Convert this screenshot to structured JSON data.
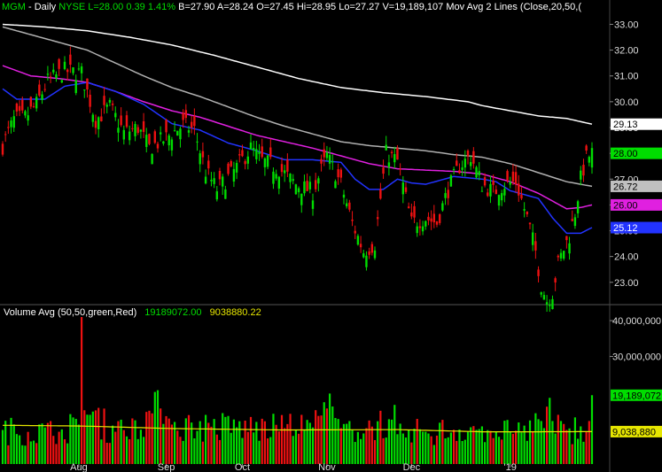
{
  "header": {
    "symbol": "MGM",
    "interval": "Daily",
    "exchange": "NYSE",
    "last": "L=28.00",
    "change": "0.39",
    "change_pct": "1.41%",
    "bid": "B=27.90",
    "ask": "A=28.24",
    "open": "O=27.45",
    "high": "Hi=28.95",
    "low": "Lo=27.27",
    "volume": "V=19,189,107",
    "study": "Mov Avg 2 Lines (Close,20,50,("
  },
  "volume_header": {
    "label": "Volume Avg (50,50,green,Red)",
    "value1": "19189072.00",
    "value2": "9038880.22"
  },
  "colors": {
    "up": "#00dd00",
    "down": "#ee1111",
    "ma20": "#2233ff",
    "ma50": "#e020e0",
    "ma100": "#b0b0b0",
    "ma200": "#ffffff",
    "vol_avg": "#e6e600",
    "grid": "#333333"
  },
  "chart_data": {
    "type": "candlestick",
    "price_axis": {
      "ticks": [
        "33.00",
        "32.00",
        "31.00",
        "30.00",
        "29.00",
        "28.00",
        "27.00",
        "26.00",
        "25.00",
        "24.00",
        "23.00"
      ],
      "ylim": [
        22.1,
        33.6
      ]
    },
    "volume_axis": {
      "ticks": [
        "40,000,000",
        "30,000,000"
      ],
      "ylim": [
        0,
        41000000
      ]
    },
    "x_labels": [
      "Aug",
      "Sep",
      "Oct",
      "Nov",
      "Dec",
      "'19"
    ],
    "price_tags": [
      {
        "label": "29.13",
        "value": 29.13,
        "color": "#ffffff",
        "text": "#000000"
      },
      {
        "label": "28.00",
        "value": 28.0,
        "color": "#00dd00",
        "text": "#000000"
      },
      {
        "label": "26.72",
        "value": 26.72,
        "color": "#c0c0c0",
        "text": "#000000"
      },
      {
        "label": "26.00",
        "value": 26.0,
        "color": "#e020e0",
        "text": "#000000"
      },
      {
        "label": "25.12",
        "value": 25.12,
        "color": "#2233ff",
        "text": "#ffffff"
      }
    ],
    "volume_tags": [
      {
        "label": "19,189,072",
        "value": 19189072,
        "color": "#00dd00",
        "text": "#000000"
      },
      {
        "label": "9,038,880",
        "value": 9038880,
        "color": "#e6e600",
        "text": "#000000"
      }
    ],
    "series": [
      {
        "name": "Mov Avg 200",
        "key": "ma200",
        "values": [
          [
            0,
            33.0
          ],
          [
            15,
            32.9
          ],
          [
            30,
            32.75
          ],
          [
            45,
            32.5
          ],
          [
            60,
            32.2
          ],
          [
            75,
            31.8
          ],
          [
            90,
            31.35
          ],
          [
            105,
            30.9
          ],
          [
            120,
            30.55
          ],
          [
            135,
            30.35
          ],
          [
            150,
            30.2
          ],
          [
            165,
            30.0
          ],
          [
            170,
            29.85
          ],
          [
            180,
            29.65
          ],
          [
            190,
            29.45
          ],
          [
            200,
            29.35
          ],
          [
            209,
            29.13
          ]
        ]
      },
      {
        "name": "Mov Avg 100",
        "key": "ma100",
        "values": [
          [
            0,
            32.9
          ],
          [
            10,
            32.6
          ],
          [
            20,
            32.3
          ],
          [
            30,
            32.0
          ],
          [
            40,
            31.5
          ],
          [
            50,
            31.0
          ],
          [
            60,
            30.55
          ],
          [
            70,
            30.2
          ],
          [
            80,
            29.8
          ],
          [
            90,
            29.4
          ],
          [
            100,
            29.05
          ],
          [
            110,
            28.75
          ],
          [
            120,
            28.45
          ],
          [
            130,
            28.3
          ],
          [
            140,
            28.2
          ],
          [
            150,
            28.1
          ],
          [
            160,
            27.95
          ],
          [
            170,
            27.85
          ],
          [
            180,
            27.6
          ],
          [
            190,
            27.25
          ],
          [
            200,
            26.9
          ],
          [
            209,
            26.72
          ]
        ]
      },
      {
        "name": "Mov Avg 50",
        "key": "ma50",
        "values": [
          [
            0,
            31.4
          ],
          [
            10,
            31.0
          ],
          [
            20,
            30.9
          ],
          [
            30,
            30.75
          ],
          [
            40,
            30.4
          ],
          [
            50,
            30.0
          ],
          [
            60,
            29.65
          ],
          [
            70,
            29.4
          ],
          [
            80,
            29.05
          ],
          [
            90,
            28.7
          ],
          [
            100,
            28.45
          ],
          [
            110,
            28.2
          ],
          [
            120,
            27.9
          ],
          [
            130,
            27.6
          ],
          [
            140,
            27.4
          ],
          [
            150,
            27.35
          ],
          [
            160,
            27.3
          ],
          [
            170,
            27.2
          ],
          [
            180,
            26.9
          ],
          [
            190,
            26.45
          ],
          [
            200,
            25.85
          ],
          [
            205,
            25.9
          ],
          [
            209,
            26.0
          ]
        ]
      },
      {
        "name": "Mov Avg 20",
        "key": "ma20",
        "values": [
          [
            0,
            30.5
          ],
          [
            5,
            30.1
          ],
          [
            15,
            30.1
          ],
          [
            22,
            30.6
          ],
          [
            30,
            30.75
          ],
          [
            40,
            30.4
          ],
          [
            50,
            29.9
          ],
          [
            60,
            29.15
          ],
          [
            70,
            28.9
          ],
          [
            80,
            28.4
          ],
          [
            90,
            28.1
          ],
          [
            100,
            27.75
          ],
          [
            110,
            27.75
          ],
          [
            120,
            27.65
          ],
          [
            125,
            27.0
          ],
          [
            130,
            26.6
          ],
          [
            135,
            26.6
          ],
          [
            140,
            27.0
          ],
          [
            145,
            26.85
          ],
          [
            150,
            26.8
          ],
          [
            160,
            27.1
          ],
          [
            170,
            27.0
          ],
          [
            175,
            26.9
          ],
          [
            180,
            26.55
          ],
          [
            185,
            26.4
          ],
          [
            190,
            26.25
          ],
          [
            195,
            25.5
          ],
          [
            200,
            24.9
          ],
          [
            205,
            24.9
          ],
          [
            209,
            25.12
          ]
        ]
      }
    ],
    "anchors": [
      [
        0,
        28.3
      ],
      [
        4,
        29.3
      ],
      [
        8,
        29.4
      ],
      [
        12,
        29.9
      ],
      [
        16,
        30.8
      ],
      [
        22,
        31.2
      ],
      [
        28,
        31.1
      ],
      [
        33,
        29.3
      ],
      [
        38,
        29.8
      ],
      [
        43,
        28.8
      ],
      [
        48,
        29.0
      ],
      [
        52,
        28.2
      ],
      [
        58,
        28.6
      ],
      [
        64,
        29.1
      ],
      [
        68,
        28.9
      ],
      [
        72,
        27.3
      ],
      [
        76,
        26.6
      ],
      [
        82,
        27.3
      ],
      [
        88,
        28.2
      ],
      [
        92,
        27.7
      ],
      [
        98,
        27.4
      ],
      [
        104,
        26.8
      ],
      [
        110,
        26.5
      ],
      [
        115,
        27.9
      ],
      [
        120,
        26.8
      ],
      [
        124,
        25.3
      ],
      [
        128,
        24.2
      ],
      [
        132,
        24.5
      ],
      [
        136,
        28.0
      ],
      [
        140,
        27.7
      ],
      [
        145,
        25.3
      ],
      [
        150,
        25.5
      ],
      [
        154,
        25.3
      ],
      [
        158,
        26.6
      ],
      [
        162,
        27.5
      ],
      [
        166,
        27.9
      ],
      [
        170,
        26.8
      ],
      [
        174,
        26.5
      ],
      [
        178,
        26.8
      ],
      [
        182,
        26.9
      ],
      [
        186,
        25.5
      ],
      [
        189,
        24.2
      ],
      [
        191,
        22.9
      ],
      [
        193,
        22.3
      ],
      [
        195,
        22.6
      ],
      [
        197,
        23.7
      ],
      [
        199,
        24.3
      ],
      [
        201,
        24.8
      ],
      [
        203,
        25.7
      ],
      [
        205,
        27.0
      ],
      [
        207,
        27.8
      ],
      [
        209,
        28.0
      ]
    ],
    "volume_anchors": [
      [
        0,
        9.5
      ],
      [
        20,
        9.0
      ],
      [
        27,
        11.0
      ],
      [
        28,
        41.0
      ],
      [
        29,
        15.0
      ],
      [
        40,
        9.0
      ],
      [
        56,
        15.5
      ],
      [
        60,
        11.0
      ],
      [
        100,
        10.0
      ],
      [
        109,
        11.5
      ],
      [
        115,
        15.5
      ],
      [
        120,
        10.0
      ],
      [
        124,
        9.5
      ],
      [
        137,
        12.5
      ],
      [
        150,
        9.0
      ],
      [
        170,
        10.5
      ],
      [
        180,
        9.0
      ],
      [
        191,
        12.0
      ],
      [
        193,
        16.0
      ],
      [
        195,
        12.0
      ],
      [
        200,
        9.5
      ],
      [
        205,
        10.5
      ],
      [
        208,
        12.0
      ],
      [
        209,
        19.2
      ]
    ],
    "vol_avg": [
      [
        0,
        10.8
      ],
      [
        28,
        10.6
      ],
      [
        60,
        9.9
      ],
      [
        100,
        9.5
      ],
      [
        140,
        9.6
      ],
      [
        170,
        9.0
      ],
      [
        190,
        9.0
      ],
      [
        209,
        9.04
      ]
    ]
  }
}
